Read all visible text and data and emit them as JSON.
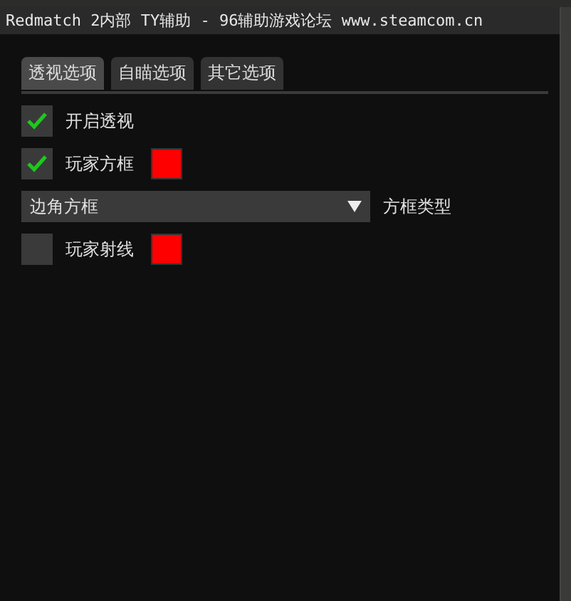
{
  "window": {
    "title": "Redmatch 2内部 TY辅助 - 96辅助游戏论坛 www.steamcom.cn"
  },
  "tabs": [
    {
      "label": "透视选项",
      "selected": true
    },
    {
      "label": "自瞄选项",
      "selected": false
    },
    {
      "label": "其它选项",
      "selected": false
    }
  ],
  "items": [
    {
      "kind": "checkbox",
      "label": "开启透视",
      "checked": true
    },
    {
      "kind": "checkbox",
      "label": "玩家方框",
      "checked": true,
      "color": "#ff0000"
    },
    {
      "kind": "combo",
      "label": "方框类型",
      "dropdown": {
        "value": "边角方框"
      }
    },
    {
      "kind": "checkbox",
      "label": "玩家射线",
      "checked": false,
      "color": "#ff0000"
    }
  ]
}
